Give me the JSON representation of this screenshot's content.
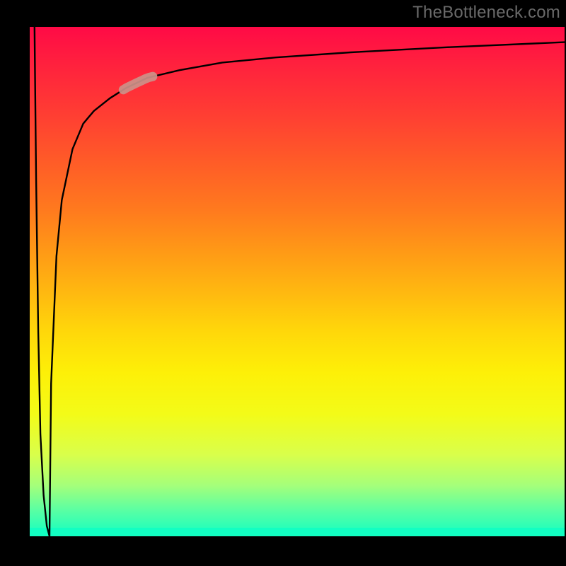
{
  "watermark": "TheBottleneck.com",
  "chart_data": {
    "type": "line",
    "title": "",
    "xlabel": "",
    "ylabel": "",
    "xlim": [
      0,
      100
    ],
    "ylim": [
      0,
      100
    ],
    "grid": false,
    "legend": false,
    "series": [
      {
        "name": "bottleneck-fit-left",
        "x": [
          0.9,
          1.2,
          1.6,
          2.0,
          2.6,
          3.2,
          3.7
        ],
        "y": [
          100,
          70,
          40,
          20,
          8,
          2,
          0
        ]
      },
      {
        "name": "bottleneck-curve",
        "x": [
          3.7,
          4.0,
          5.0,
          6.0,
          8.0,
          10.0,
          12.0,
          15.0,
          18.0,
          22.0,
          28.0,
          36.0,
          46.0,
          60.0,
          78.0,
          100.0
        ],
        "y": [
          0,
          30,
          55,
          66,
          76,
          81,
          83.5,
          86,
          88,
          90,
          91.5,
          93,
          94,
          95,
          96,
          97
        ]
      }
    ],
    "annotations": [
      {
        "name": "highlight-segment",
        "x_range": [
          17.5,
          23.0
        ],
        "y_range": [
          87,
          90
        ],
        "color": "#cc9189"
      }
    ],
    "colors": {
      "curve": "#000000",
      "highlight": "#cc9189",
      "gradient_top": "#ff0a46",
      "gradient_mid": "#ffd80a",
      "gradient_bottom": "#12ffc2",
      "border": "#000000"
    }
  }
}
